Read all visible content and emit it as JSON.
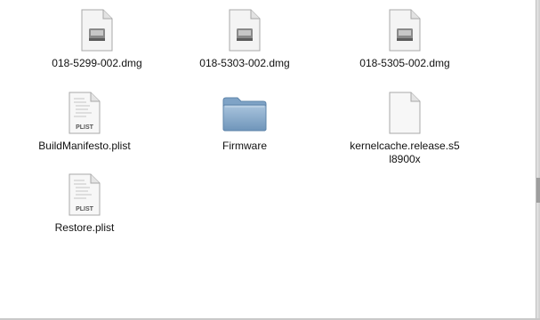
{
  "files": [
    {
      "name": "018-5299-002.dmg",
      "icon": "disk-image-icon"
    },
    {
      "name": "018-5303-002.dmg",
      "icon": "disk-image-icon"
    },
    {
      "name": "018-5305-002.dmg",
      "icon": "disk-image-icon"
    },
    {
      "name": "BuildManifesto.plist",
      "icon": "plist-document-icon",
      "badge": "PLIST"
    },
    {
      "name": "Firmware",
      "icon": "folder-icon"
    },
    {
      "name": "kernelcache.release.s5l8900x",
      "icon": "blank-document-icon"
    },
    {
      "name": "Restore.plist",
      "icon": "plist-document-icon",
      "badge": "PLIST"
    }
  ]
}
